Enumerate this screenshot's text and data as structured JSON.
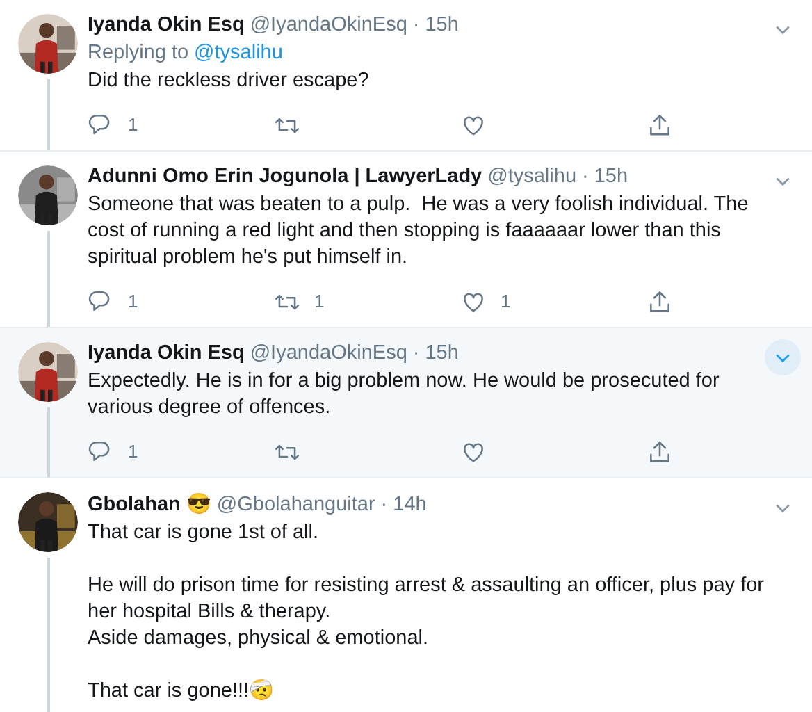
{
  "tweets": [
    {
      "name": "Iyanda Okin Esq",
      "handle": "@IyandaOkinEsq",
      "separator": "·",
      "time": "15h",
      "replying_label": "Replying to",
      "replying_to": "@tysalihu",
      "text": "Did the reckless driver escape?",
      "hovered": false,
      "thread_line": true,
      "actions": [
        {
          "kind": "reply",
          "count": "1"
        },
        {
          "kind": "retweet"
        },
        {
          "kind": "like"
        },
        {
          "kind": "share"
        }
      ]
    },
    {
      "name": "Adunni Omo Erin Jogunola | LawyerLady",
      "handle": "@tysalihu",
      "separator": "·",
      "time": "15h",
      "text": "Someone that was beaten to a pulp.  He was a very foolish individual. The cost of running a red light and then stopping is faaaaaar lower than this spiritual problem he's put himself in.",
      "hovered": false,
      "thread_line": true,
      "actions": [
        {
          "kind": "reply",
          "count": "1"
        },
        {
          "kind": "retweet",
          "count": "1"
        },
        {
          "kind": "like",
          "count": "1"
        },
        {
          "kind": "share"
        }
      ]
    },
    {
      "name": "Iyanda Okin Esq",
      "handle": "@IyandaOkinEsq",
      "separator": "·",
      "time": "15h",
      "text": "Expectedly. He is in for a big problem now. He would be prosecuted for various degree of offences.",
      "hovered": true,
      "thread_line": true,
      "actions": [
        {
          "kind": "reply",
          "count": "1"
        },
        {
          "kind": "retweet"
        },
        {
          "kind": "like"
        },
        {
          "kind": "share"
        }
      ]
    },
    {
      "name": "Gbolahan 😎",
      "handle": "@Gbolahanguitar",
      "separator": "·",
      "time": "14h",
      "text": "That car is gone 1st of all.\n\nHe will do prison time for resisting arrest & assaulting an officer, plus pay for her hospital Bills & therapy.\nAside damages, physical & emotional.\n\nThat car is gone!!!🤕",
      "hovered": false,
      "thread_line": true
    }
  ]
}
